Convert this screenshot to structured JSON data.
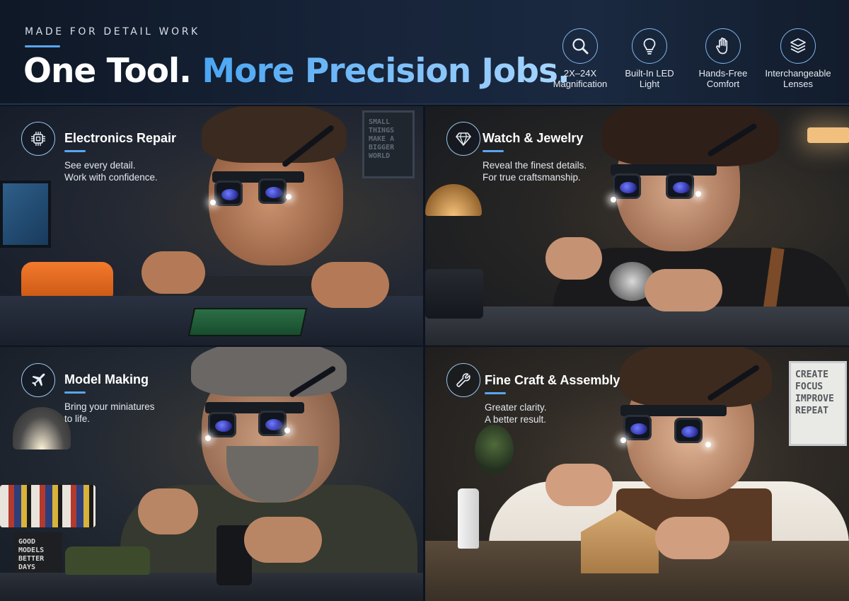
{
  "header": {
    "eyebrow": "MADE FOR DETAIL WORK",
    "headline_part1": "One Tool.",
    "headline_part2": "More Precision Jobs."
  },
  "features": [
    {
      "icon": "magnifier-icon",
      "label": "2X–24X\nMagnification"
    },
    {
      "icon": "lightbulb-icon",
      "label": "Built-In LED\nLight"
    },
    {
      "icon": "hand-icon",
      "label": "Hands-Free\nComfort"
    },
    {
      "icon": "layers-icon",
      "label": "Interchangeable\nLenses"
    }
  ],
  "panels": [
    {
      "icon": "chip-icon",
      "title": "Electronics Repair",
      "description": "See every detail.\nWork with confidence.",
      "poster": "SMALL\nTHINGS\nMAKE A\nBIGGER\nWORLD"
    },
    {
      "icon": "diamond-icon",
      "title": "Watch & Jewelry",
      "description": "Reveal the finest details.\nFor true craftsmanship."
    },
    {
      "icon": "airplane-icon",
      "title": "Model Making",
      "description": "Bring your miniatures\nto life.",
      "mug": "GOOD\nMODELS\nBETTER\nDAYS"
    },
    {
      "icon": "wrench-icon",
      "title": "Fine Craft & Assembly",
      "description": "Greater clarity.\nA better result.",
      "poster": "CREATE\nFOCUS\nIMPROVE\nREPEAT"
    }
  ],
  "colors": {
    "accent": "#58a6f0",
    "headline_highlight": "#6db6f5",
    "background": "#0d1420"
  }
}
